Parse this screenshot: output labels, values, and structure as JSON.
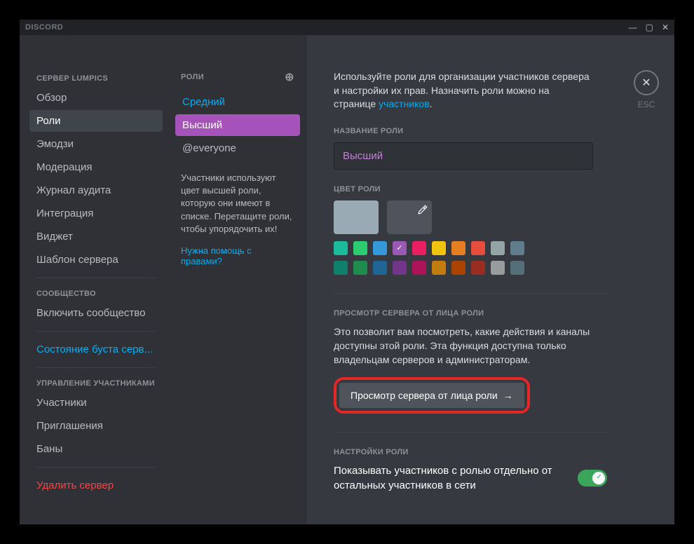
{
  "titlebar": {
    "title": "DISCORD"
  },
  "sidebar": {
    "server_header": "СЕРВЕР LUMPICS",
    "items": [
      "Обзор",
      "Роли",
      "Эмодзи",
      "Модерация",
      "Журнал аудита",
      "Интеграция",
      "Виджет",
      "Шаблон сервера"
    ],
    "community_header": "СООБЩЕСТВО",
    "community_items": [
      "Включить сообщество"
    ],
    "boost_status": "Состояние буста серв...",
    "members_header": "УПРАВЛЕНИЕ УЧАСТНИКАМИ",
    "members_items": [
      "Участники",
      "Приглашения",
      "Баны"
    ],
    "delete_server": "Удалить сервер"
  },
  "roles": {
    "header": "РОЛИ",
    "list": [
      "Средний",
      "Высший",
      "@everyone"
    ],
    "hint": "Участники используют цвет высшей роли, которую они имеют в списке. Перетащите роли, чтобы упорядочить их!",
    "help_link": "Нужна помощь с правами?"
  },
  "main": {
    "esc_label": "ESC",
    "intro_pre": "Используйте роли для организации участников сервера и настройки их прав. Назначить роли можно на странице ",
    "intro_link": "участников",
    "role_name_label": "НАЗВАНИЕ РОЛИ",
    "role_name_value": "Высший",
    "role_color_label": "ЦВЕТ РОЛИ",
    "colors_row1": [
      "#1abc9c",
      "#2ecc71",
      "#3498db",
      "#9b59b6",
      "#e91e63",
      "#f1c40f",
      "#e67e22",
      "#e74c3c",
      "#95a5a6",
      "#607d8b"
    ],
    "colors_row2": [
      "#11806a",
      "#1f8b4c",
      "#206694",
      "#71368a",
      "#ad1457",
      "#c27c0e",
      "#a84300",
      "#992d22",
      "#979c9f",
      "#546e7a"
    ],
    "selected_color_index": 3,
    "view_as_header": "ПРОСМОТР СЕРВЕРА ОТ ЛИЦА РОЛИ",
    "view_as_desc": "Это позволит вам посмотреть, какие действия и каналы доступны этой роли. Эта функция доступна только владельцам серверов и администраторам.",
    "view_as_button": "Просмотр сервера от лица роли",
    "role_settings_header": "НАСТРОЙКИ РОЛИ",
    "display_separately_label": "Показывать участников с ролью отдельно от остальных участников в сети"
  }
}
